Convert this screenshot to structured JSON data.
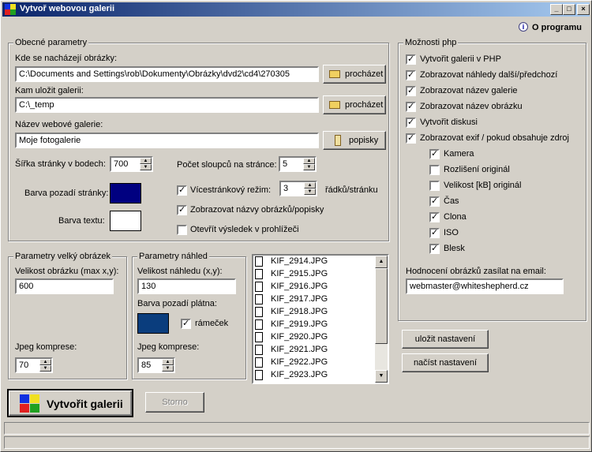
{
  "window": {
    "title": "Vytvoř webovou galerii",
    "min": "_",
    "max": "□",
    "close": "×"
  },
  "about_link": "O programu",
  "general": {
    "legend": "Obecné parametry",
    "images_label": "Kde se nacházejí obrázky:",
    "images_path": "C:\\Documents and Settings\\rob\\Dokumenty\\Obrázky\\dvd2\\cd4\\270305",
    "save_label": "Kam uložit galerii:",
    "save_path": "C:\\_temp",
    "browse": "procházet",
    "name_label": "Název webové galerie:",
    "name_value": "Moje fotogalerie",
    "captions_btn": "popisky",
    "width_label": "Šířka stránky v bodech:",
    "width_value": "700",
    "cols_label": "Počet sloupců na stránce:",
    "cols_value": "5",
    "bg_label": "Barva pozadí stránky:",
    "bg_color": "#000080",
    "text_label": "Barva textu:",
    "text_color": "#ffffff",
    "multipage_label": "Vícestránkový režim:",
    "multipage_checked": true,
    "rows_value": "3",
    "rows_unit": "řádků/stránku",
    "show_names_label": "Zobrazovat názvy obrázků/popisky",
    "show_names_checked": true,
    "open_label": "Otevřít výsledek v prohlížeči",
    "open_checked": false
  },
  "php": {
    "legend": "Možnosti php",
    "options": [
      {
        "label": "Vytvořit galerii v PHP",
        "checked": true
      },
      {
        "label": "Zobrazovat náhledy další/předchozí",
        "checked": true
      },
      {
        "label": "Zobrazovat název galerie",
        "checked": true
      },
      {
        "label": "Zobrazovat název obrázku",
        "checked": true
      },
      {
        "label": "Vytvořit diskusi",
        "checked": true
      },
      {
        "label": "Zobrazovat exif / pokud obsahuje zdroj",
        "checked": true
      }
    ],
    "exif": [
      {
        "label": "Kamera",
        "checked": true
      },
      {
        "label": "Rozlišení originál",
        "checked": false
      },
      {
        "label": "Velikost [kB] originál",
        "checked": false
      },
      {
        "label": "Čas",
        "checked": true
      },
      {
        "label": "Clona",
        "checked": true
      },
      {
        "label": "ISO",
        "checked": true
      },
      {
        "label": "Blesk",
        "checked": true
      }
    ],
    "email_label": "Hodnocení obrázků zasílat na email:",
    "email_value": "webmaster@whiteshepherd.cz"
  },
  "large": {
    "legend": "Parametry velký obrázek",
    "size_label": "Velikost obrázku (max x,y):",
    "size_value": "600",
    "jpeg_label": "Jpeg komprese:",
    "jpeg_value": "70"
  },
  "thumb": {
    "legend": "Parametry náhled",
    "size_label": "Velikost náhledu (x,y):",
    "size_value": "130",
    "bg_label": "Barva pozadí plátna:",
    "bg_color": "#0a3d7d",
    "frame_label": "rámeček",
    "frame_checked": true,
    "jpeg_label": "Jpeg komprese:",
    "jpeg_value": "85"
  },
  "files": [
    "KIF_2914.JPG",
    "KIF_2915.JPG",
    "KIF_2916.JPG",
    "KIF_2917.JPG",
    "KIF_2918.JPG",
    "KIF_2919.JPG",
    "KIF_2920.JPG",
    "KIF_2921.JPG",
    "KIF_2922.JPG",
    "KIF_2923.JPG"
  ],
  "buttons": {
    "save_settings": "uložit nastavení",
    "load_settings": "načíst nastavení",
    "create": "Vytvořit galerii",
    "cancel": "Storno"
  }
}
